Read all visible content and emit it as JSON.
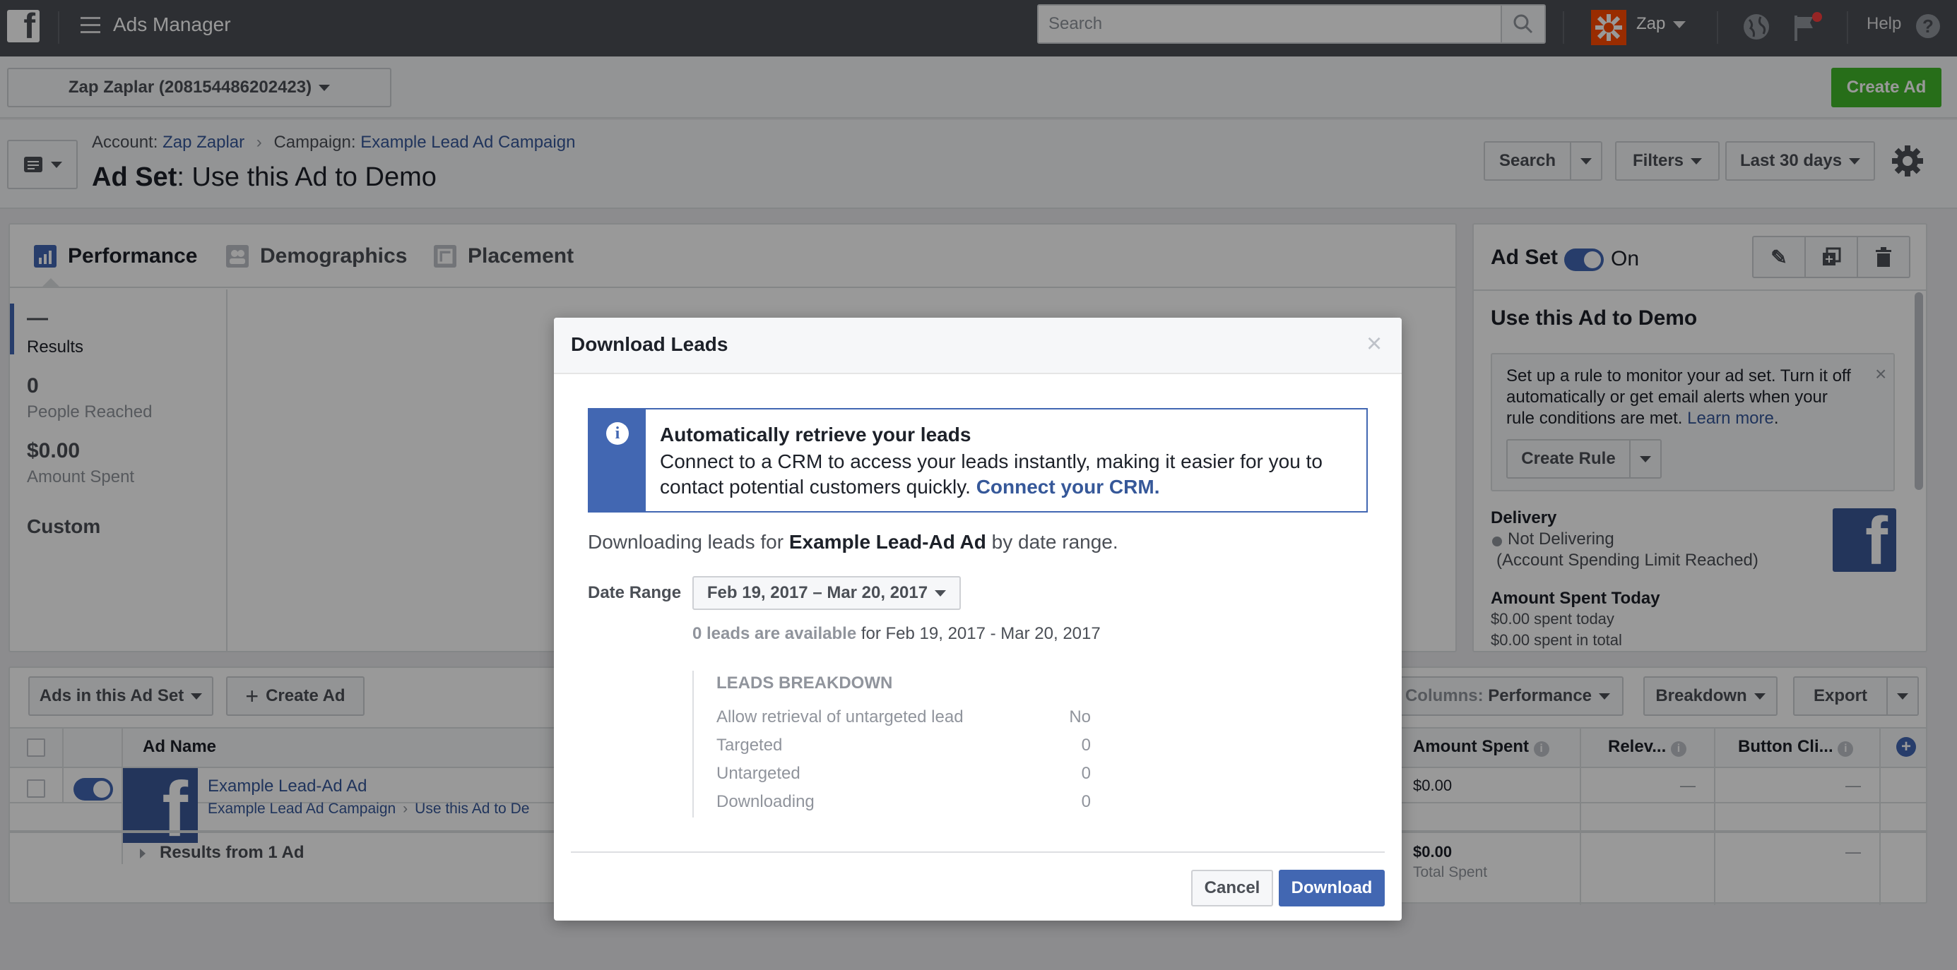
{
  "topbar": {
    "app_title": "Ads Manager",
    "search_placeholder": "Search",
    "account_name": "Zap",
    "help_label": "Help"
  },
  "account_selector": {
    "label": "Zap Zaplar (208154486202423)"
  },
  "create_ad_label": "Create Ad",
  "breadcrumb": {
    "account_prefix": "Account",
    "account_name": "Zap Zaplar",
    "campaign_prefix": "Campaign",
    "campaign_name": "Example Lead Ad Campaign"
  },
  "page_title": {
    "prefix": "Ad Set",
    "name": "Use this Ad to Demo"
  },
  "toolbar": {
    "search": "Search",
    "filters": "Filters",
    "date": "Last 30 days"
  },
  "tabs": [
    "Performance",
    "Demographics",
    "Placement"
  ],
  "metrics": [
    {
      "value": "—",
      "label": "Results"
    },
    {
      "value": "0",
      "label": "People Reached"
    },
    {
      "value": "$0.00",
      "label": "Amount Spent"
    }
  ],
  "custom_label": "Custom",
  "right_panel": {
    "header": "Ad Set",
    "toggle_label": "On",
    "title": "Use this Ad to Demo",
    "tip_text": "Set up a rule to monitor your ad set. Turn it off automatically or get email alerts when your rule conditions are met.",
    "tip_link": "Learn more",
    "create_rule": "Create Rule",
    "delivery_title": "Delivery",
    "delivery_status": "Not Delivering",
    "delivery_reason": "(Account Spending Limit Reached)",
    "spent_today_title": "Amount Spent Today",
    "spent_today": "$0.00 spent today",
    "spent_total": "$0.00 spent in total"
  },
  "table_toolbar": {
    "ads_dropdown": "Ads in this Ad Set",
    "create_ad": "Create Ad",
    "columns_prefix": "Columns:",
    "columns_value": "Performance",
    "breakdown": "Breakdown",
    "export": "Export"
  },
  "table": {
    "headers": {
      "ad_name": "Ad Name",
      "amount_spent": "Amount Spent",
      "relevance": "Relev...",
      "button_clicks": "Button Cli..."
    },
    "row": {
      "name": "Example Lead-Ad Ad",
      "campaign": "Example Lead Ad Campaign",
      "adset": "Use this Ad to De",
      "amount": "$0.00",
      "relevance": "—",
      "clicks": "—"
    },
    "summary": {
      "label": "Results from 1 Ad",
      "amount": "$0.00",
      "amount_sub": "Total Spent",
      "clicks": "—"
    }
  },
  "modal": {
    "title": "Download Leads",
    "info_title": "Automatically retrieve your leads",
    "info_body": "Connect to a CRM to access your leads instantly, making it easier for you to contact potential customers quickly.",
    "info_link": "Connect your CRM.",
    "downloading_prefix": "Downloading leads for",
    "ad_name": "Example Lead-Ad Ad",
    "downloading_suffix": "by date range.",
    "date_range_label": "Date Range",
    "date_range_value": "Feb 19, 2017 – Mar 20, 2017",
    "available_bold": "0 leads are available",
    "available_rest": "for Feb 19, 2017 - Mar 20, 2017",
    "breakdown_title": "LEADS BREAKDOWN",
    "breakdown": [
      {
        "label": "Allow retrieval of untargeted lead",
        "value": "No"
      },
      {
        "label": "Targeted",
        "value": "0"
      },
      {
        "label": "Untargeted",
        "value": "0"
      },
      {
        "label": "Downloading",
        "value": "0"
      }
    ],
    "cancel": "Cancel",
    "download": "Download"
  }
}
